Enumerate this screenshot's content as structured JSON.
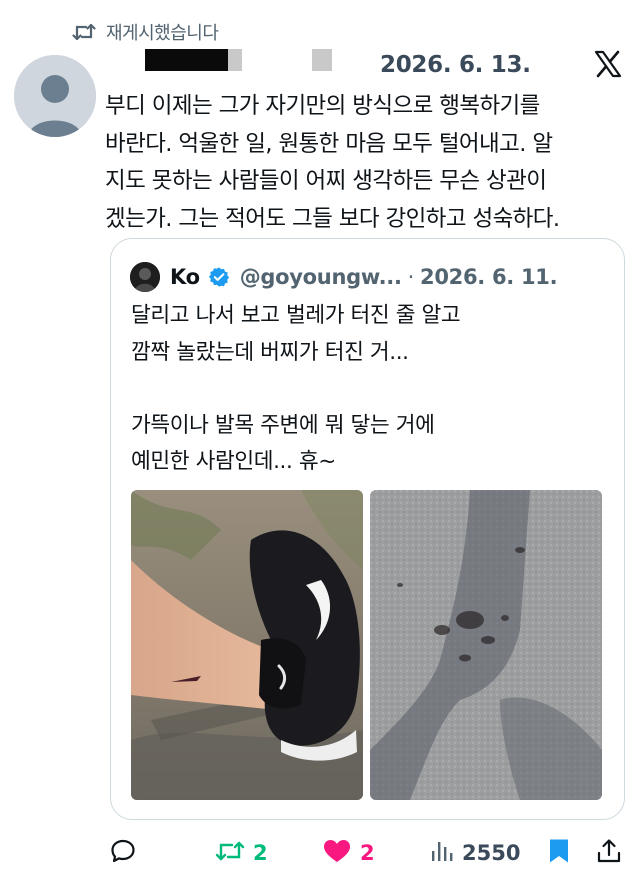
{
  "repost": {
    "label": "재게시했습니다",
    "icon": "repost-icon"
  },
  "tweet": {
    "date": "2026. 6. 13.",
    "text": "부디 이제는 그가 자기만의 방식으로 행복하기를\n바란다. 억울한 일, 원통한 마음 모두 털어내고. 알\n지도 못하는 사람들이 어찌 생각하든 무슨 상관이\n겠는가. 그는 적어도 그들 보다 강인하고 성숙하다."
  },
  "quote": {
    "name": "Ko",
    "handle": "@goyoungw...",
    "separator": "·",
    "date": "2026. 6. 11.",
    "text": "달리고 나서 보고 벌레가 터진 줄 알고\n깜짝 놀랐는데 버찌가 터진 거...\n\n가뜩이나 발목 주변에 뭐 닿는 거에\n예민한 사람인데... 휴~"
  },
  "stats": {
    "reposts": "2",
    "likes": "2",
    "views": "2550"
  },
  "colors": {
    "repost_active": "#00ba7c",
    "like_active": "#f91880",
    "verified": "#1d9bf0",
    "bookmark_active": "#1d9bf0",
    "border": "#cfd9de"
  }
}
